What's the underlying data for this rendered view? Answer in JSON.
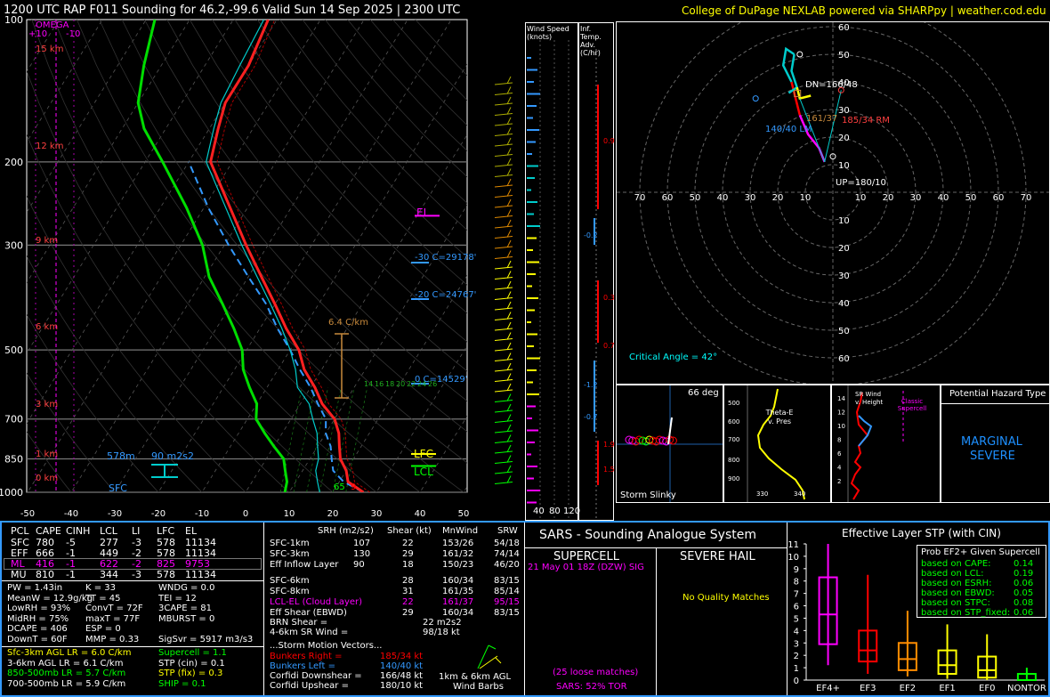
{
  "header": {
    "title": "1200 UTC RAP F011 Sounding for 46.2,-99.6 Valid  Sun 14 Sep 2025 | 2300 UTC",
    "credit": "College of DuPage NEXLAB powered via SHARPpy | weather.cod.edu"
  },
  "skewt": {
    "pressure_labels": [
      "100",
      "200",
      "300",
      "500",
      "700",
      "850",
      "1000"
    ],
    "temp_labels": [
      "-50",
      "-40",
      "-30",
      "-20",
      "-10",
      "0",
      "10",
      "20",
      "30",
      "40",
      "50"
    ],
    "omega_label": "OMEGA",
    "omega_ticks": [
      "+10",
      "-10"
    ],
    "height_labels": [
      "15 km",
      "12 km",
      "9 km",
      "6 km",
      "3 km",
      "1 km",
      "0 km"
    ],
    "el_label": "EL",
    "lfc_label": "LFC",
    "lcl_label": "LCL",
    "sfc_label": "SFC",
    "m578_label": "578m",
    "helicity_label": "90 m2s2",
    "lapse_label": "6.4 C/km",
    "isotherm_labels": [
      "-30 C=29178'",
      "-20 C=24767'",
      "0 C=14529'"
    ],
    "wetbulb_labels": [
      "14",
      "16",
      "18",
      "20",
      "22",
      "24",
      "26"
    ],
    "sfc_t": "65",
    "sfc_td": "9",
    "chart_data": {
      "type": "line",
      "title": "",
      "xlabel": "",
      "ylabel": "",
      "xlim": [
        -50,
        50
      ],
      "ylim": [
        1000,
        100
      ],
      "series": [
        {
          "points": [
            [
              27,
              1000
            ],
            [
              22,
              950
            ],
            [
              20,
              900
            ],
            [
              17,
              850
            ],
            [
              15,
              800
            ],
            [
              13,
              750
            ],
            [
              10,
              700
            ],
            [
              5,
              650
            ],
            [
              1,
              600
            ],
            [
              -4,
              550
            ],
            [
              -8,
              500
            ],
            [
              -14,
              450
            ],
            [
              -20,
              400
            ],
            [
              -27,
              350
            ],
            [
              -35,
              300
            ],
            [
              -44,
              250
            ],
            [
              -55,
              200
            ],
            [
              -58,
              170
            ],
            [
              -60,
              150
            ],
            [
              -60,
              125
            ],
            [
              -62,
              100
            ]
          ]
        },
        {
          "points": [
            [
              9,
              1000
            ],
            [
              8,
              950
            ],
            [
              6,
              900
            ],
            [
              4,
              850
            ],
            [
              0,
              800
            ],
            [
              -4,
              750
            ],
            [
              -8,
              700
            ],
            [
              -10,
              650
            ],
            [
              -14,
              600
            ],
            [
              -18,
              550
            ],
            [
              -21,
              500
            ],
            [
              -26,
              450
            ],
            [
              -32,
              400
            ],
            [
              -39,
              350
            ],
            [
              -45,
              300
            ],
            [
              -54,
              250
            ],
            [
              -66,
              200
            ],
            [
              -75,
              170
            ],
            [
              -80,
              150
            ],
            [
              -84,
              125
            ],
            [
              -88,
              100
            ]
          ]
        },
        {
          "points": [
            [
              17,
              1000
            ],
            [
              15,
              950
            ],
            [
              13,
              900
            ],
            [
              12,
              850
            ],
            [
              10,
              800
            ],
            [
              8,
              750
            ],
            [
              5,
              700
            ],
            [
              2,
              650
            ],
            [
              -3,
              600
            ],
            [
              -6,
              550
            ],
            [
              -10,
              500
            ],
            [
              -15,
              450
            ],
            [
              -21,
              400
            ],
            [
              -28,
              350
            ],
            [
              -36,
              300
            ],
            [
              -45,
              250
            ],
            [
              -56,
              200
            ],
            [
              -59,
              170
            ],
            [
              -61,
              150
            ],
            [
              -62,
              125
            ],
            [
              -63,
              100
            ]
          ]
        },
        {
          "points": [
            [
              27,
              1000
            ],
            [
              21,
              950
            ],
            [
              17,
              900
            ],
            [
              15,
              850
            ],
            [
              13,
              800
            ],
            [
              10,
              750
            ],
            [
              8,
              700
            ],
            [
              4,
              650
            ],
            [
              0,
              600
            ],
            [
              -5,
              550
            ],
            [
              -10,
              500
            ],
            [
              -16,
              450
            ],
            [
              -22,
              400
            ],
            [
              -30,
              350
            ],
            [
              -39,
              300
            ],
            [
              -49,
              250
            ],
            [
              -60,
              200
            ]
          ]
        }
      ]
    }
  },
  "windspeed": {
    "title": "Wind Speed (knots)",
    "ticks": [
      "40",
      "80",
      "120"
    ]
  },
  "inftemp": {
    "title": "Inf. Temp. Adv. (C/hr)",
    "values": [
      "0.9",
      "-0.2",
      "0.3",
      "0.7",
      "-1.2",
      "-0.7",
      "1.9",
      "1.5"
    ]
  },
  "hodograph": {
    "ring_labels": [
      "60",
      "50",
      "40",
      "30",
      "20",
      "10"
    ],
    "axis_labels": [
      "70",
      "60",
      "50",
      "40",
      "30",
      "20",
      "10",
      "10",
      "20",
      "30",
      "40",
      "50",
      "60",
      "70"
    ],
    "dn_label": "DN=166/48",
    "rm_label": "185/34 RM",
    "lm_label": "140/40 LM",
    "up_label": "UP=180/10",
    "mean_label": "161/37",
    "crit_label": "Critical Angle = 42°"
  },
  "slinky": {
    "deg": "66 deg",
    "title": "Storm Slinky"
  },
  "thetae": {
    "title": "Theta-E v. Pres",
    "p_ticks": [
      "500",
      "600",
      "700",
      "800",
      "900"
    ],
    "x_ticks": [
      "330",
      "340"
    ]
  },
  "srwind": {
    "title": "SR Wind v. Height",
    "y_ticks": [
      "14",
      "12",
      "10",
      "8",
      "6",
      "4",
      "2"
    ],
    "classic_label": "Classic Supercell"
  },
  "hazard": {
    "title": "Potential Hazard Type",
    "value_line1": "MARGINAL",
    "value_line2": "SEVERE"
  },
  "params": {
    "header": [
      "PCL",
      "CAPE",
      "CINH",
      "LCL",
      "LI",
      "LFC",
      "EL"
    ],
    "rows": [
      [
        "SFC",
        "780",
        "-5",
        "277",
        "-3",
        "578",
        "11134"
      ],
      [
        "EFF",
        "666",
        "-1",
        "449",
        "-2",
        "578",
        "11134"
      ],
      [
        "ML",
        "416",
        "-1",
        "622",
        "-2",
        "825",
        "9753"
      ],
      [
        "MU",
        "810",
        "-1",
        "344",
        "-3",
        "578",
        "11134"
      ]
    ],
    "col1": [
      "PW = 1.43in",
      "MeanW = 12.9g/kg",
      "LowRH = 93%",
      "MidRH = 75%",
      "DCAPE = 406",
      "DownT = 60F"
    ],
    "col2": [
      "K = 33",
      "TT = 45",
      "ConvT = 72F",
      "maxT = 77F",
      "ESP = 0",
      "MMP = 0.33"
    ],
    "col3": [
      "WNDG = 0.0",
      "TEI = 12",
      "3CAPE = 81",
      "MBURST = 0",
      "",
      "SigSvr = 5917 m3/s3"
    ],
    "lapse": [
      "Sfc-3km AGL LR = 6.0 C/km",
      "3-6km AGL LR = 6.1 C/km",
      "850-500mb LR = 5.7 C/km",
      "700-500mb LR = 5.9 C/km"
    ],
    "comp": [
      "Supercell = 1.1",
      "STP (cin) = 0.1",
      "STP (fix) = 0.3",
      "SHIP = 0.1"
    ]
  },
  "kin": {
    "header": [
      "SRH (m2/s2)",
      "Shear (kt)",
      "MnWind",
      "SRW"
    ],
    "rows": [
      [
        "SFC-1km",
        "107",
        "22",
        "153/26",
        "54/18"
      ],
      [
        "SFC-3km",
        "130",
        "29",
        "161/32",
        "74/14"
      ],
      [
        "Eff Inflow Layer",
        "90",
        "18",
        "150/23",
        "46/20"
      ],
      [
        "",
        "",
        "",
        "",
        ""
      ],
      [
        "SFC-6km",
        "28",
        "160/34",
        "83/15",
        ""
      ],
      [
        "SFC-8km",
        "31",
        "161/35",
        "85/14",
        ""
      ],
      [
        "LCL-EL (Cloud Layer)",
        "22",
        "161/37",
        "95/15",
        ""
      ],
      [
        "Eff Shear (EBWD)",
        "29",
        "160/34",
        "83/15",
        ""
      ]
    ],
    "brn": [
      "BRN Shear =",
      "22 m2s2"
    ],
    "srwind46": [
      "4-6km SR Wind =",
      "98/18 kt"
    ],
    "sm_title": "...Storm Motion Vectors...",
    "sm": [
      [
        "Bunkers Right =",
        "185/34 kt"
      ],
      [
        "Bunkers Left =",
        "140/40 kt"
      ],
      [
        "Corfidi Downshear =",
        "166/48 kt"
      ],
      [
        "Corfidi Upshear =",
        "180/10 kt"
      ]
    ],
    "barbs_label1": "1km & 6km AGL",
    "barbs_label2": "Wind Barbs"
  },
  "sars": {
    "title": "SARS - Sounding Analogue System",
    "supercell": "SUPERCELL",
    "hail": "SEVERE HAIL",
    "match": "21 May 01 18Z (DZW) SIG",
    "noq": "No Quality Matches",
    "loose": "(25 loose matches)",
    "tor": "SARS: 52% TOR"
  },
  "stp": {
    "title": "Effective Layer STP (with CIN)",
    "legend_title": "Prob EF2+ Given Supercell",
    "legend": [
      [
        "based on CAPE:",
        "0.14"
      ],
      [
        "based on LCL:",
        "0.19"
      ],
      [
        "based on ESRH:",
        "0.06"
      ],
      [
        "based on EBWD:",
        "0.05"
      ],
      [
        "based on STPC:",
        "0.08"
      ],
      [
        "based on STP_fixed:",
        "0.06"
      ]
    ],
    "y_ticks": [
      "11",
      "10",
      "9",
      "8",
      "7",
      "6",
      "5",
      "4",
      "3",
      "2",
      "1",
      "0"
    ],
    "chart_data": {
      "type": "bar",
      "title": "Effective Layer STP (with CIN)",
      "categories": [
        "EF4+",
        "EF3",
        "EF2",
        "EF1",
        "EF0",
        "NONTOR"
      ],
      "boxes": [
        {
          "min": 1.2,
          "q1": 2.9,
          "median": 5.3,
          "q3": 8.3,
          "max": 11.0
        },
        {
          "min": 0.5,
          "q1": 1.5,
          "median": 2.4,
          "q3": 4.0,
          "max": 8.5
        },
        {
          "min": 0.3,
          "q1": 0.8,
          "median": 1.7,
          "q3": 3.0,
          "max": 5.6
        },
        {
          "min": 0.1,
          "q1": 0.5,
          "median": 1.2,
          "q3": 2.4,
          "max": 4.5
        },
        {
          "min": 0.0,
          "q1": 0.2,
          "median": 0.8,
          "q3": 1.9,
          "max": 3.7
        },
        {
          "min": 0.0,
          "q1": 0.0,
          "median": 0.0,
          "q3": 0.5,
          "max": 1.0
        }
      ],
      "colors": [
        "#ff00ff",
        "#ff0000",
        "#ff8c00",
        "#ffff00",
        "#ffff00",
        "#00ff00"
      ],
      "ylim": [
        0,
        11
      ]
    }
  }
}
